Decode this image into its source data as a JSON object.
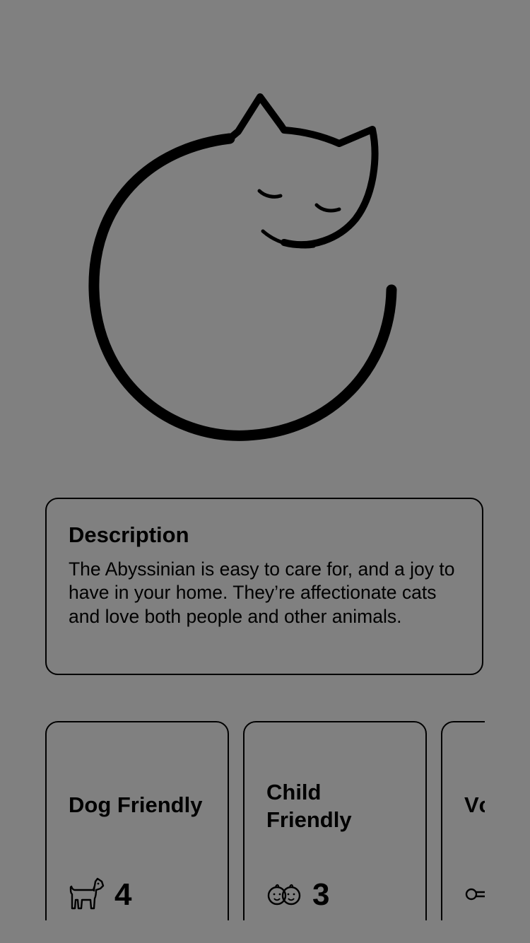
{
  "hero": {
    "image_icon": "sleeping-cat-outline-icon"
  },
  "description": {
    "title": "Description",
    "text": "The Abyssinian is easy to care for, and a joy to have in your home. They’re affectionate cats and love both people and other animals."
  },
  "traits": [
    {
      "title": "Dog Friendly",
      "value": "4",
      "icon": "dog-icon"
    },
    {
      "title": "Child Friendly",
      "value": "3",
      "icon": "children-faces-icon"
    },
    {
      "title": "Vc",
      "value": "",
      "icon": "key-icon"
    }
  ],
  "colors": {
    "background": "#808080",
    "stroke": "#000000"
  }
}
